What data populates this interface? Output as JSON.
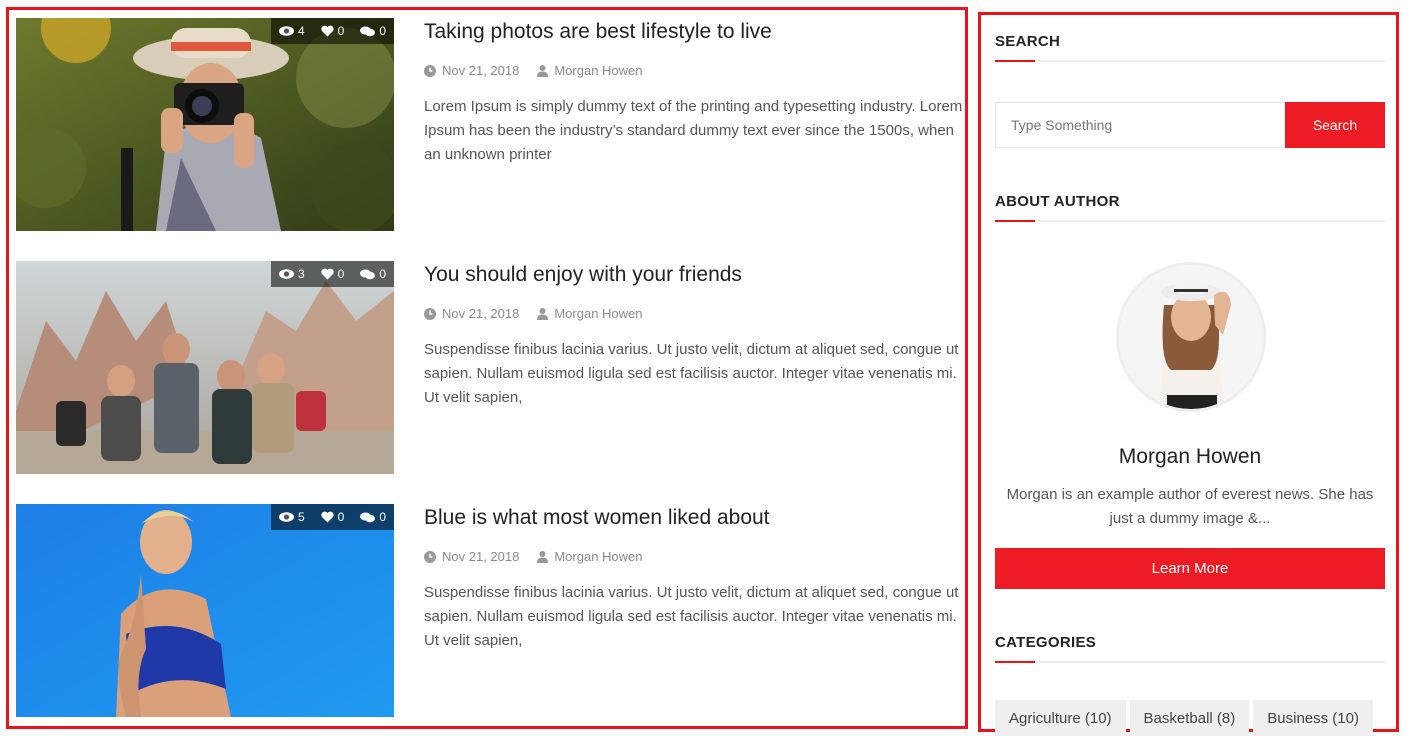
{
  "posts": [
    {
      "title": "Taking photos are best lifestyle to live",
      "date": "Nov 21, 2018",
      "author": "Morgan Howen",
      "excerpt": "Lorem Ipsum is simply dummy text of the printing and typesetting industry. Lorem Ipsum has been the industry’s standard dummy text ever since the 1500s, when an unknown printer",
      "views": "4",
      "likes": "0",
      "comments": "0"
    },
    {
      "title": "You should enjoy with your friends",
      "date": "Nov 21, 2018",
      "author": "Morgan Howen",
      "excerpt": "Suspendisse finibus lacinia varius. Ut justo velit, dictum at aliquet sed, congue ut sapien. Nullam euismod ligula sed est facilisis auctor. Integer vitae venenatis mi. Ut velit sapien,",
      "views": "3",
      "likes": "0",
      "comments": "0"
    },
    {
      "title": "Blue is what most women liked about",
      "date": "Nov 21, 2018",
      "author": "Morgan Howen",
      "excerpt": "Suspendisse finibus lacinia varius. Ut justo velit, dictum at aliquet sed, congue ut sapien. Nullam euismod ligula sed est facilisis auctor. Integer vitae venenatis mi. Ut velit sapien,",
      "views": "5",
      "likes": "0",
      "comments": "0"
    }
  ],
  "sidebar": {
    "search": {
      "title": "SEARCH",
      "placeholder": "Type Something",
      "button_label": "Search"
    },
    "about": {
      "title": "ABOUT AUTHOR",
      "name": "Morgan Howen",
      "bio": "Morgan is an example author of everest news. She has just a dummy image &...",
      "button_label": "Learn More"
    },
    "categories": {
      "title": "CATEGORIES",
      "items": [
        {
          "label": "Agriculture (10)"
        },
        {
          "label": "Basketball (8)"
        },
        {
          "label": "Business (10)"
        }
      ]
    }
  },
  "colors": {
    "accent": "#ed1c24",
    "frame": "#e8141c"
  },
  "icons": {
    "views": "eye-icon",
    "likes": "heart-icon",
    "comments": "comments-icon",
    "date": "clock-icon",
    "author": "user-icon"
  }
}
